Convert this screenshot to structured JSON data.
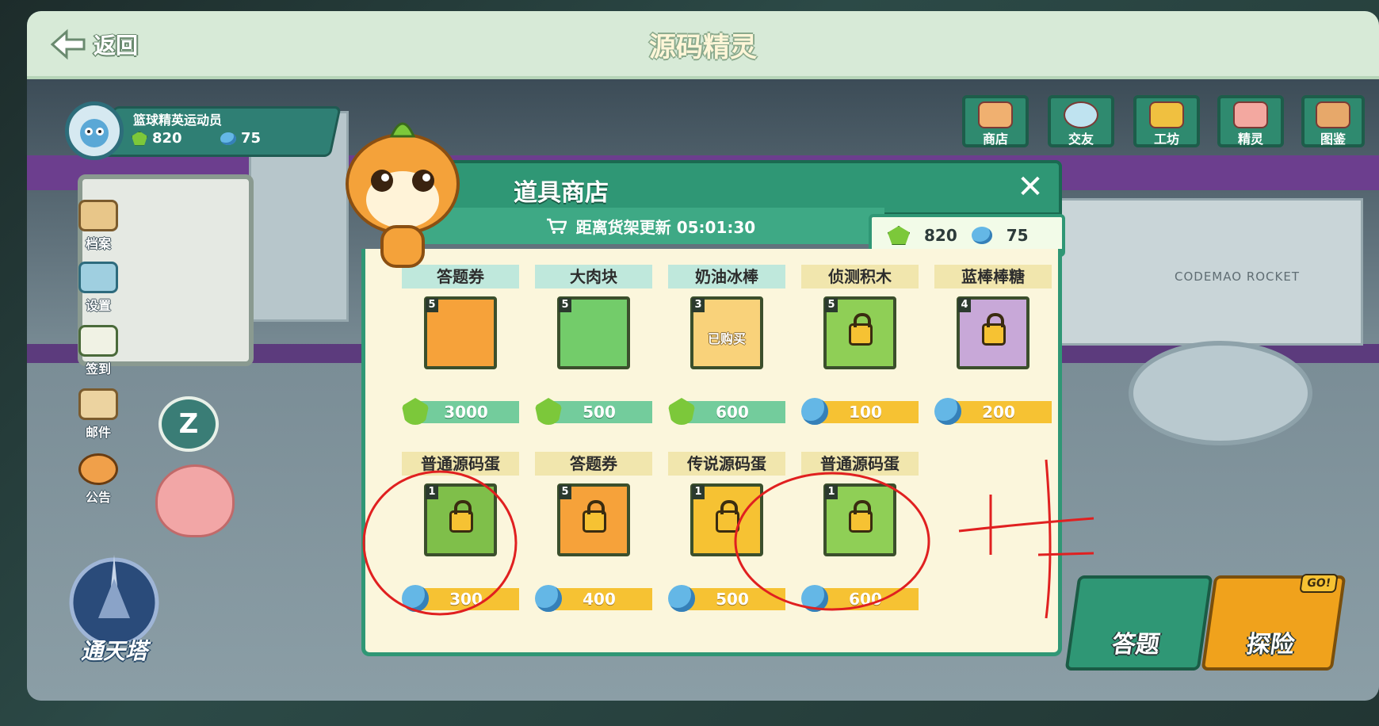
{
  "header": {
    "back_label": "返回",
    "title": "源码精灵"
  },
  "player": {
    "name": "篮球精英运动员",
    "green_gems": "820",
    "blue_gems": "75"
  },
  "side_menu": [
    {
      "label": "档案",
      "icon": "profile-icon"
    },
    {
      "label": "设置",
      "icon": "settings-icon"
    },
    {
      "label": "签到",
      "icon": "checkin-icon"
    },
    {
      "label": "邮件",
      "icon": "mail-icon"
    },
    {
      "label": "公告",
      "icon": "announcement-icon"
    }
  ],
  "top_menu": [
    {
      "label": "商店",
      "icon": "shop-icon"
    },
    {
      "label": "交友",
      "icon": "friends-icon"
    },
    {
      "label": "工坊",
      "icon": "workshop-icon"
    },
    {
      "label": "精灵",
      "icon": "sprite-icon"
    },
    {
      "label": "图鉴",
      "icon": "album-icon"
    }
  ],
  "shop": {
    "title": "道具商店",
    "refresh_text": "距离货架更新 05:01:30",
    "wallet": {
      "green": "820",
      "blue": "75"
    },
    "items": [
      {
        "name": "答题券",
        "qty": "5",
        "price": "3000",
        "currency": "green",
        "locked": false,
        "bought": false
      },
      {
        "name": "大肉块",
        "qty": "5",
        "price": "500",
        "currency": "green",
        "locked": false,
        "bought": false
      },
      {
        "name": "奶油冰棒",
        "qty": "3",
        "price": "600",
        "currency": "green",
        "locked": false,
        "bought": true,
        "bought_label": "已购买"
      },
      {
        "name": "侦测积木",
        "qty": "5",
        "price": "100",
        "currency": "blue",
        "locked": true,
        "bought": false
      },
      {
        "name": "蓝棒棒糖",
        "qty": "4",
        "price": "200",
        "currency": "blue",
        "locked": true,
        "bought": false
      },
      {
        "name": "普通源码蛋",
        "qty": "1",
        "price": "300",
        "currency": "blue",
        "locked": true,
        "bought": false
      },
      {
        "name": "答题券",
        "qty": "5",
        "price": "400",
        "currency": "blue",
        "locked": true,
        "bought": false
      },
      {
        "name": "传说源码蛋",
        "qty": "1",
        "price": "500",
        "currency": "blue",
        "locked": true,
        "bought": false
      },
      {
        "name": "普通源码蛋",
        "qty": "1",
        "price": "600",
        "currency": "blue",
        "locked": true,
        "bought": false
      }
    ]
  },
  "bottom": {
    "tower_label": "通天塔",
    "answer_label": "答题",
    "explore_label": "探险",
    "go_badge": "GO!"
  },
  "background_text": {
    "rocket": "CODEMAO ROCKET",
    "zzz": "Z"
  },
  "colors": {
    "accent": "#2f9775",
    "price_gold": "#f6c233",
    "annotation_red": "#e02020"
  }
}
